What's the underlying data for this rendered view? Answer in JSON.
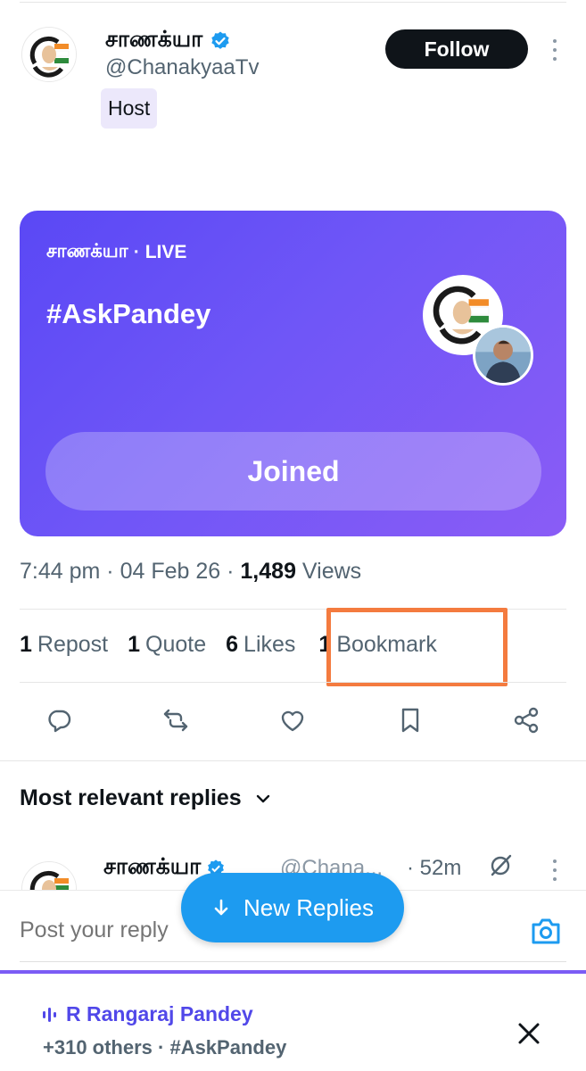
{
  "header": {
    "user_name": "சாணக்யா",
    "user_handle": "@ChanakyaaTv",
    "host_badge": "Host",
    "follow_label": "Follow"
  },
  "space": {
    "host_label": "சாணக்யா",
    "separator": "·",
    "status": "LIVE",
    "title": "#AskPandey",
    "joined_label": "Joined"
  },
  "meta": {
    "time": "7:44 pm",
    "dot1": "·",
    "date": "04 Feb 26",
    "dot2": "·",
    "views_count": "1,489",
    "views_label": "Views"
  },
  "stats": [
    {
      "count": "1",
      "label": "Repost"
    },
    {
      "count": "1",
      "label": "Quote"
    },
    {
      "count": "6",
      "label": "Likes"
    },
    {
      "count": "1",
      "label": "Bookmark"
    }
  ],
  "actions": {
    "reply_icon": "reply-icon",
    "repost_icon": "repost-icon",
    "like_icon": "heart-icon",
    "bookmark_icon": "bookmark-icon",
    "share_icon": "share-icon"
  },
  "sort": {
    "label": "Most relevant replies"
  },
  "reply": {
    "name": "சாணக்யா",
    "handle": "@Chana...",
    "time": "· 52m"
  },
  "compose": {
    "placeholder": "Post your reply"
  },
  "new_replies": {
    "label": "New Replies"
  },
  "dock": {
    "speaker": "R Rangaraj Pandey",
    "subtitle": "+310 others · #AskPandey"
  },
  "colors": {
    "accent_blue": "#1d9bf0",
    "space_purple": "#6f56f7",
    "highlight_orange": "#f47b3f",
    "verified_blue": "#1d9bf0"
  }
}
